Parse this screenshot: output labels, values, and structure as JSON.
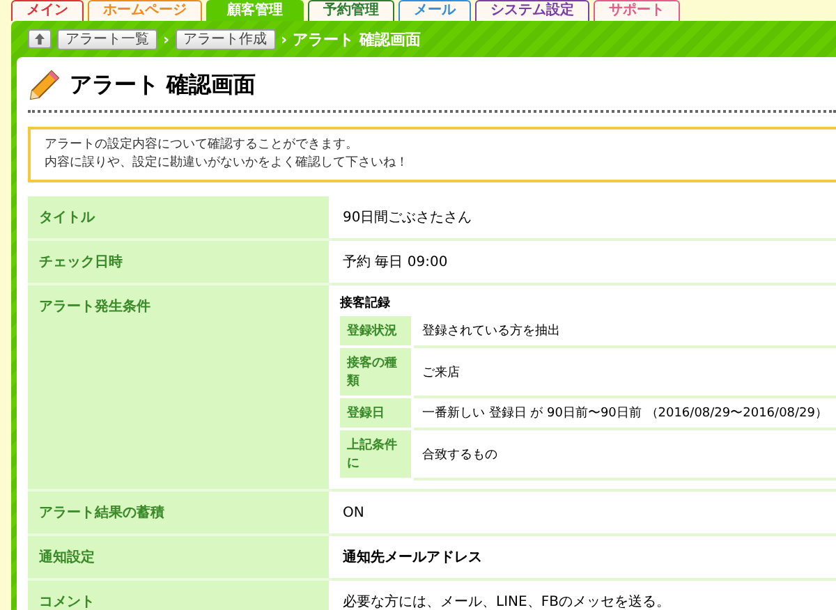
{
  "tabs": [
    {
      "label": "メイン",
      "selected": false,
      "color": "#e0303a"
    },
    {
      "label": "ホームページ",
      "selected": false,
      "color": "#f08a1c"
    },
    {
      "label": "顧客管理",
      "selected": true,
      "color": "#5cc800"
    },
    {
      "label": "予約管理",
      "selected": false,
      "color": "#2e7d32"
    },
    {
      "label": "メール",
      "selected": false,
      "color": "#2f8fe0"
    },
    {
      "label": "システム設定",
      "selected": false,
      "color": "#7b3fa8"
    },
    {
      "label": "サポート",
      "selected": false,
      "color": "#e85a8a"
    }
  ],
  "breadcrumb": {
    "separator": "›",
    "links": [
      "アラート一覧",
      "アラート作成"
    ],
    "current": "アラート 確認画面"
  },
  "page_title": "アラート 確認画面",
  "notice": [
    "アラートの設定内容について確認することができます。",
    "内容に誤りや、設定に勘違いがないかをよく確認して下さいね！"
  ],
  "rows": [
    {
      "kind": "text",
      "label": "タイトル",
      "value": "90日間ごぶさたさん"
    },
    {
      "kind": "text",
      "label": "チェック日時",
      "value": "予約 毎日 09:00"
    },
    {
      "kind": "conditions",
      "label": "アラート発生条件",
      "heading": "接客記録",
      "items": [
        {
          "label": "登録状況",
          "value": "登録されている方を抽出"
        },
        {
          "label": "接客の種類",
          "value": "ご来店"
        },
        {
          "label": "登録日",
          "value": "一番新しい 登録日 が 90日前〜90日前 （2016/08/29〜2016/08/29）"
        },
        {
          "label": "上記条件に",
          "value": "合致するもの"
        }
      ]
    },
    {
      "kind": "text",
      "label": "アラート結果の蓄積",
      "value": "ON"
    },
    {
      "kind": "bold",
      "label": "通知設定",
      "value": "通知先メールアドレス"
    },
    {
      "kind": "text",
      "label": "コメント",
      "value": "必要な方には、メール、LINE、FBのメッセを送る。"
    }
  ]
}
